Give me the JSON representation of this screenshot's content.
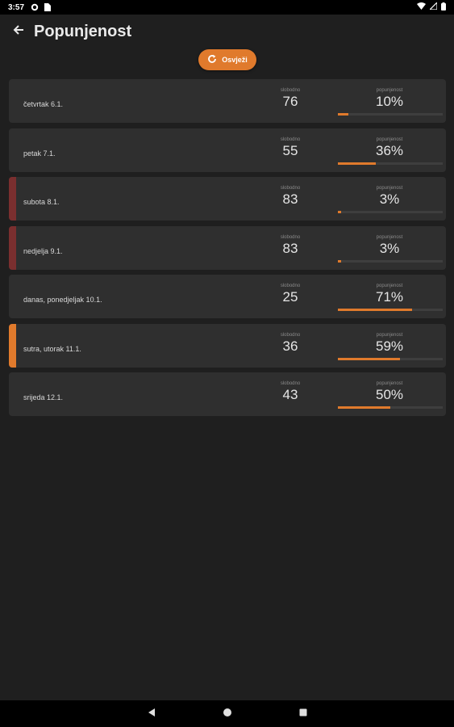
{
  "status": {
    "time": "3:57"
  },
  "header": {
    "title": "Popunjenost"
  },
  "toolbar": {
    "refresh_label": "Osvježi"
  },
  "labels": {
    "free": "slobodno",
    "occupancy": "popunjenost"
  },
  "colors": {
    "accent": "#e07a2c",
    "weekend": "#7a2f2f",
    "card": "#2f2f2f",
    "background": "#1f1f1f"
  },
  "days": [
    {
      "label": "četvrtak 6.1.",
      "free": "76",
      "occupancy": "10%",
      "fill": 0.1,
      "marker": "none"
    },
    {
      "label": "petak 7.1.",
      "free": "55",
      "occupancy": "36%",
      "fill": 0.36,
      "marker": "none"
    },
    {
      "label": "subota 8.1.",
      "free": "83",
      "occupancy": "3%",
      "fill": 0.03,
      "marker": "weekend"
    },
    {
      "label": "nedjelja 9.1.",
      "free": "83",
      "occupancy": "3%",
      "fill": 0.03,
      "marker": "weekend"
    },
    {
      "label": "danas, ponedjeljak 10.1.",
      "free": "25",
      "occupancy": "71%",
      "fill": 0.71,
      "marker": "none"
    },
    {
      "label": "sutra, utorak 11.1.",
      "free": "36",
      "occupancy": "59%",
      "fill": 0.59,
      "marker": "accent"
    },
    {
      "label": "srijeda 12.1.",
      "free": "43",
      "occupancy": "50%",
      "fill": 0.5,
      "marker": "none"
    }
  ],
  "icons": {
    "back": "arrow-left-icon",
    "refresh": "refresh-icon",
    "nav_back": "nav-back-icon",
    "nav_home": "nav-home-icon",
    "nav_recents": "nav-recents-icon"
  }
}
